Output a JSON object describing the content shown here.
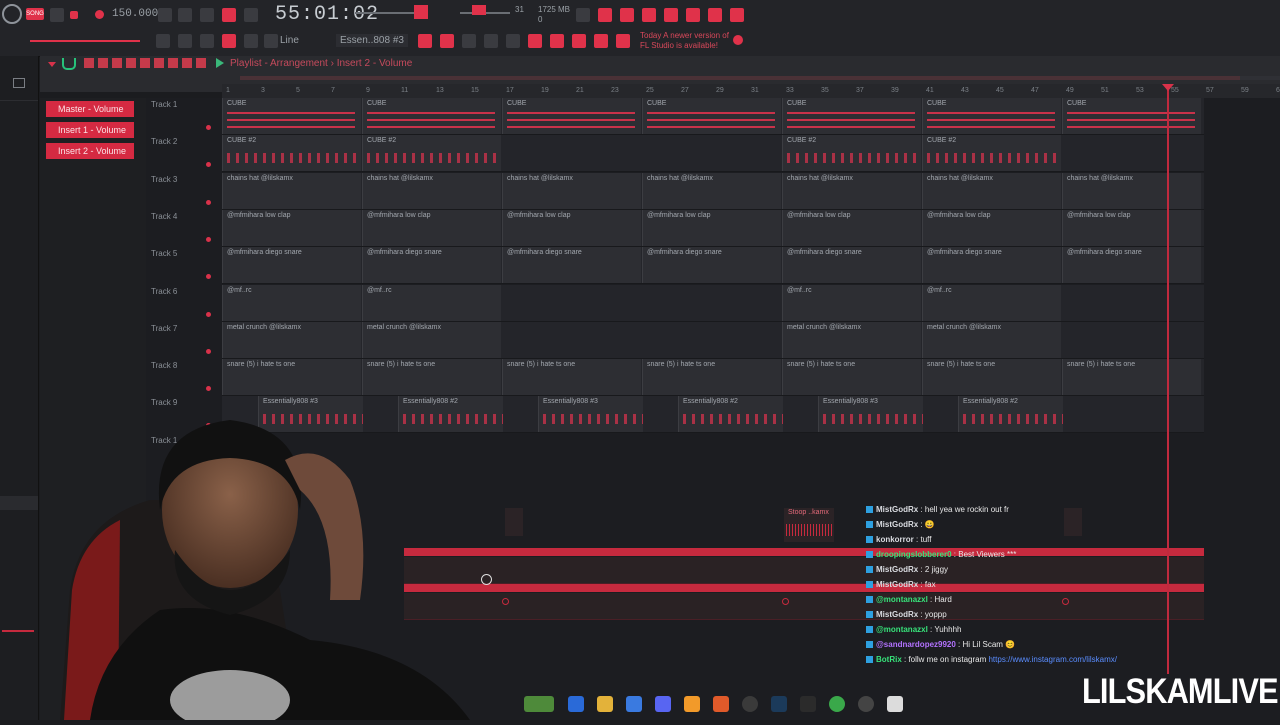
{
  "toolbar": {
    "song_mode": "SONG",
    "tempo": "150.000",
    "time": "55:01:02",
    "line_mode": "Line",
    "pattern": "Essen..808 #3",
    "cpu": "31",
    "memory": "1725 MB",
    "memory_sub": "0",
    "update_notice_line1": "Today  A newer version of",
    "update_notice_line2": "FL Studio is available!"
  },
  "playlist": {
    "breadcrumb": "Playlist - Arrangement  ›  Insert 2 - Volume",
    "ruler_ticks": [
      "1",
      "3",
      "5",
      "7",
      "9",
      "11",
      "13",
      "15",
      "17",
      "19",
      "21",
      "23",
      "25",
      "27",
      "29",
      "31",
      "33",
      "35",
      "37",
      "39",
      "41",
      "43",
      "45",
      "47",
      "49",
      "51",
      "53",
      "55",
      "57",
      "59",
      "61"
    ]
  },
  "side_panel": {
    "items": [
      "Master - Volume",
      "Insert 1 - Volume",
      "Insert 2 - Volume"
    ]
  },
  "tracks": [
    {
      "label": "Track 1",
      "clip": "CUBE"
    },
    {
      "label": "Track 2",
      "clip": "CUBE #2"
    },
    {
      "label": "Track 3",
      "clip": "chains hat @lilskamx"
    },
    {
      "label": "Track 4",
      "clip": "@mfmihara low clap"
    },
    {
      "label": "Track 5",
      "clip": "@mfmihara diego snare"
    },
    {
      "label": "Track 6",
      "clip": "@mf..rc"
    },
    {
      "label": "Track 7",
      "clip": "metal crunch @lilskamx"
    },
    {
      "label": "Track 8",
      "clip": "snare (5) i hate ts one"
    },
    {
      "label": "Track 9",
      "clip": "Essentially808 #3",
      "clip_alt": "Essentially808 #2"
    },
    {
      "label": "Track 1"
    }
  ],
  "sample_clip": "Stoop ..kamx",
  "chat": [
    {
      "user": "MistGodRx",
      "color": "normal",
      "msg": " : hell yea we rockin out fr"
    },
    {
      "user": "MistGodRx",
      "color": "normal",
      "msg": " : 😀"
    },
    {
      "user": "konkorror",
      "color": "normal",
      "msg": " : tuff"
    },
    {
      "user": "droopingslobberer0",
      "color": "g",
      "msg": " : Best Viewers ***"
    },
    {
      "user": "MistGodRx",
      "color": "normal",
      "msg": " : 2 jiggy"
    },
    {
      "user": "MistGodRx",
      "color": "normal",
      "msg": " : fax"
    },
    {
      "user": "@montanazxl",
      "color": "g",
      "msg": " : Hard"
    },
    {
      "user": "MistGodRx",
      "color": "normal",
      "msg": " : yoppp"
    },
    {
      "user": "@montanazxl",
      "color": "g",
      "msg": " : Yuhhhh"
    },
    {
      "user": "@sandnardopez9920",
      "color": "p",
      "msg": " : Hi Lil Scam 😊"
    },
    {
      "user": "BotRix",
      "color": "g",
      "msg": " : follw me on instagram ",
      "link": "https://www.instagram.com/lilskamx/"
    }
  ],
  "brand": "LILSKAMLIVE",
  "colors": {
    "accent": "#d52a42",
    "bg": "#1b1c1f"
  }
}
